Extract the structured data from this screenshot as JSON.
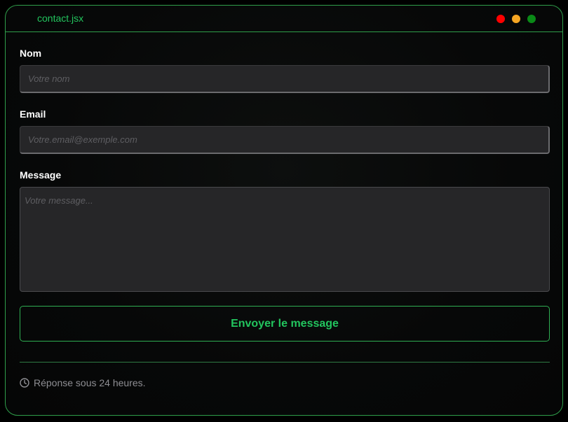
{
  "window": {
    "title": "contact.jsx",
    "controls": [
      {
        "name": "close",
        "color": "#ff0000"
      },
      {
        "name": "minimize",
        "color": "#f5a623"
      },
      {
        "name": "maximize",
        "color": "#0a8a17"
      }
    ]
  },
  "form": {
    "name_label": "Nom",
    "name_placeholder": "Votre nom",
    "email_label": "Email",
    "email_placeholder": "Votre.email@exemple.com",
    "message_label": "Message",
    "message_placeholder": "Votre message...",
    "submit_label": "Envoyer le message"
  },
  "footer": {
    "icon": "clock-icon",
    "text": "Réponse sous 24 heures."
  },
  "colors": {
    "accent": "#22c55e",
    "border": "#2f9e4a"
  }
}
